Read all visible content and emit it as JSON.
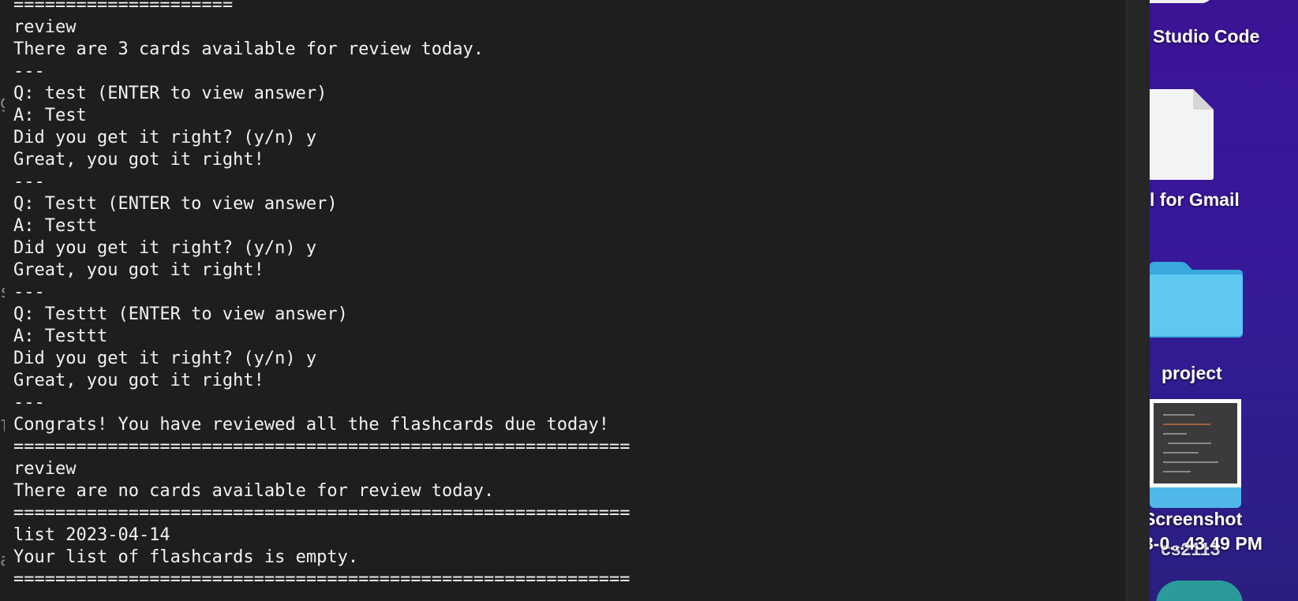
{
  "terminal": {
    "lines": [
      "=====================",
      "review",
      "There are 3 cards available for review today.",
      "---",
      "Q: test (ENTER to view answer)",
      "A: Test",
      "Did you get it right? (y/n) y",
      "Great, you got it right!",
      "---",
      "Q: Testt (ENTER to view answer)",
      "A: Testt",
      "Did you get it right? (y/n) y",
      "Great, you got it right!",
      "---",
      "Q: Testtt (ENTER to view answer)",
      "A: Testtt",
      "Did you get it right? (y/n) y",
      "Great, you got it right!",
      "---",
      "Congrats! You have reviewed all the flashcards due today!",
      "===========================================================",
      "review",
      "There are no cards available for review today.",
      "===========================================================",
      "list 2023-04-14",
      "Your list of flashcards is empty.",
      "==========================================================="
    ],
    "background_color": "#1e1e1e",
    "text_color": "#f2f2f2"
  },
  "desktop": {
    "labels": {
      "vscode": "Studio Code",
      "gmail": "l for Gmail",
      "project": "project",
      "screenshot": "Screenshot",
      "screenshot_time": "3-0...43.49 PM",
      "cs2113": "cs2113"
    },
    "icons": [
      "app-icon",
      "document-icon",
      "folder-icon",
      "screenshot-thumbnail-icon",
      "app-icon"
    ]
  }
}
